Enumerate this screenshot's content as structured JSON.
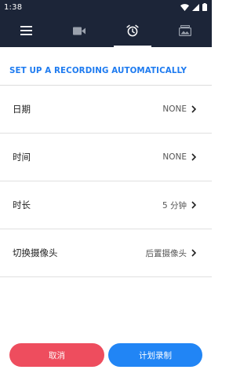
{
  "status_bar": {
    "time": "1:38",
    "icons": [
      "wifi-icon",
      "signal-icon",
      "battery-icon"
    ]
  },
  "tabs": [
    {
      "name": "menu",
      "icon": "menu-icon"
    },
    {
      "name": "video",
      "icon": "video-camera-icon"
    },
    {
      "name": "schedule",
      "icon": "alarm-clock-icon",
      "active": true
    },
    {
      "name": "gallery",
      "icon": "gallery-icon"
    }
  ],
  "section": {
    "title": "SET UP A RECORDING AUTOMATICALLY"
  },
  "settings": [
    {
      "label": "日期",
      "value": "NONE"
    },
    {
      "label": "时间",
      "value": "NONE"
    },
    {
      "label": "时长",
      "value": "5 分钟"
    },
    {
      "label": "切换摄像头",
      "value": "后置摄像头"
    }
  ],
  "actions": {
    "cancel_label": "取消",
    "schedule_label": "计划录制"
  },
  "colors": {
    "header_bg": "#1c2538",
    "accent_blue": "#2185f5",
    "title_blue": "#1e7bf0",
    "cancel_red": "#ee4d5e"
  }
}
